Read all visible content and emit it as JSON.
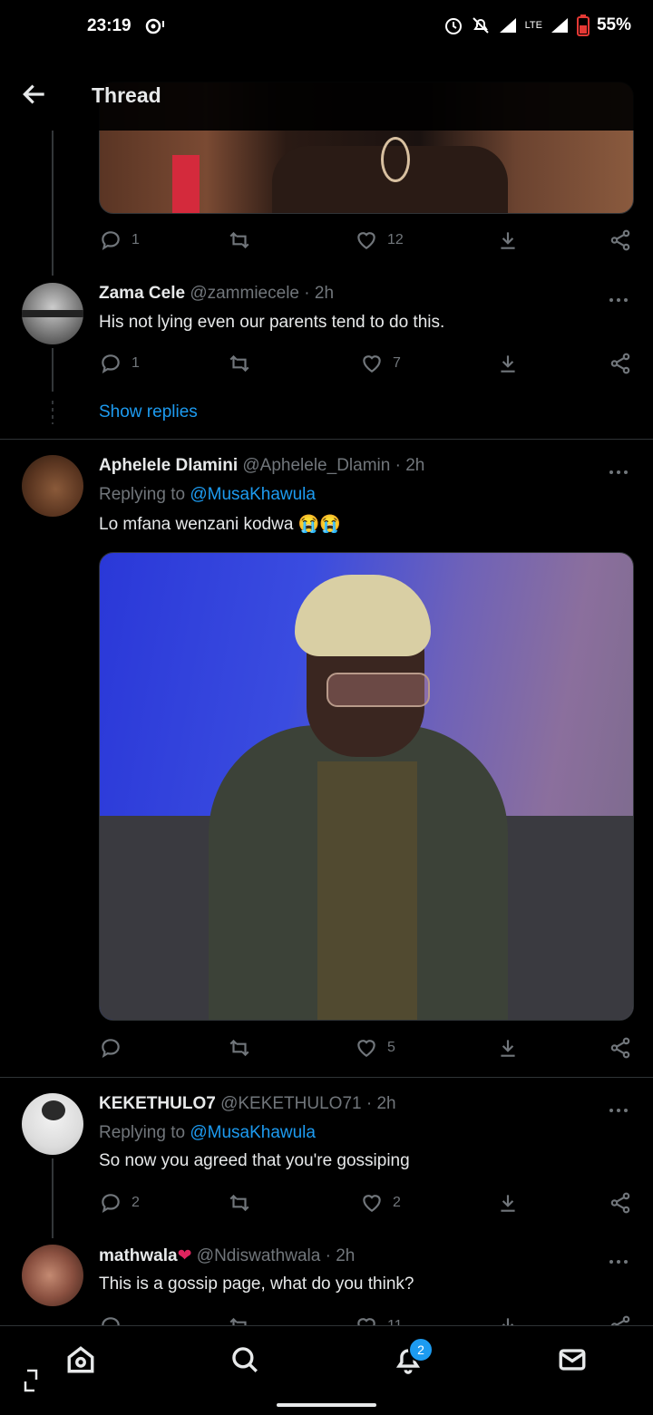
{
  "status_bar": {
    "time": "23:19",
    "battery": "55%",
    "network": "LTE"
  },
  "header": {
    "title": "Thread"
  },
  "tweets": [
    {
      "id": "top",
      "actions": {
        "replies": "1",
        "retweets": "",
        "likes": "12"
      }
    },
    {
      "id": "zama",
      "name": "Zama Cele",
      "handle": "@zammiecele",
      "time": "· 2h",
      "text": "His not lying even our parents tend to do this.",
      "actions": {
        "replies": "1",
        "retweets": "",
        "likes": "7"
      },
      "show_replies": "Show replies"
    },
    {
      "id": "aphelele",
      "name": "Aphelele Dlamini",
      "handle": "@Aphelele_Dlamin",
      "time": "· 2h",
      "replying_prefix": "Replying to",
      "replying_to": "@MusaKhawula",
      "text": "Lo mfana wenzani kodwa 😭😭",
      "actions": {
        "replies": "",
        "retweets": "",
        "likes": "5"
      }
    },
    {
      "id": "kekethulo",
      "name": "KEKETHULO7",
      "handle": "@KEKETHULO71",
      "time": "· 2h",
      "replying_prefix": "Replying to",
      "replying_to": "@MusaKhawula",
      "text": "So now you agreed that you're gossiping",
      "actions": {
        "replies": "2",
        "retweets": "",
        "likes": "2"
      }
    },
    {
      "id": "mathwala",
      "name": "mathwala",
      "handle": "@Ndiswathwala",
      "time": "· 2h",
      "text": "This is a gossip page, what do you think?",
      "actions": {
        "likes": "11"
      }
    }
  ],
  "bottom_nav": {
    "notifications_badge": "2"
  },
  "colors": {
    "accent": "#1d9bf0",
    "muted": "#71767b",
    "like_heart": "#f91880"
  }
}
